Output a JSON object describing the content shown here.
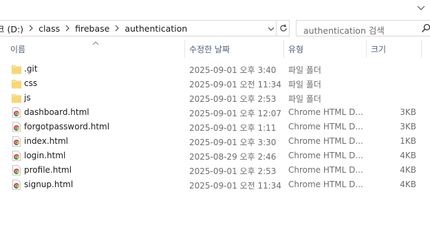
{
  "address": {
    "segments": [
      "크 (D:)",
      "class",
      "firebase",
      "authentication"
    ]
  },
  "search": {
    "placeholder": "authentication 검색"
  },
  "columns": {
    "name": "이름",
    "modified": "수정한 날짜",
    "type": "유형",
    "size": "크기"
  },
  "files": [
    {
      "name": ".git",
      "date": "2025-09-01 오후 3:40",
      "type": "파일 폴더",
      "size": "",
      "icon": "folder-icon"
    },
    {
      "name": "css",
      "date": "2025-09-01 오전 11:34",
      "type": "파일 폴더",
      "size": "",
      "icon": "folder-icon"
    },
    {
      "name": "js",
      "date": "2025-09-01 오후 2:53",
      "type": "파일 폴더",
      "size": "",
      "icon": "folder-icon"
    },
    {
      "name": "dashboard.html",
      "date": "2025-09-01 오후 12:07",
      "type": "Chrome HTML D...",
      "size": "3KB",
      "icon": "chrome-file-icon"
    },
    {
      "name": "forgotpassword.html",
      "date": "2025-09-01 오후 1:11",
      "type": "Chrome HTML D...",
      "size": "3KB",
      "icon": "chrome-file-icon"
    },
    {
      "name": "index.html",
      "date": "2025-09-01 오후 3:30",
      "type": "Chrome HTML D...",
      "size": "1KB",
      "icon": "chrome-file-icon"
    },
    {
      "name": "login.html",
      "date": "2025-08-29 오후 2:46",
      "type": "Chrome HTML D...",
      "size": "4KB",
      "icon": "chrome-file-icon"
    },
    {
      "name": "profile.html",
      "date": "2025-09-01 오후 2:53",
      "type": "Chrome HTML D...",
      "size": "4KB",
      "icon": "chrome-file-icon"
    },
    {
      "name": "signup.html",
      "date": "2025-09-01 오전 11:34",
      "type": "Chrome HTML D...",
      "size": "4KB",
      "icon": "chrome-file-icon"
    }
  ],
  "colors": {
    "header_text": "#4c607a",
    "folder_yellow": "#f8d775",
    "muted_text": "#6d6d6d"
  }
}
